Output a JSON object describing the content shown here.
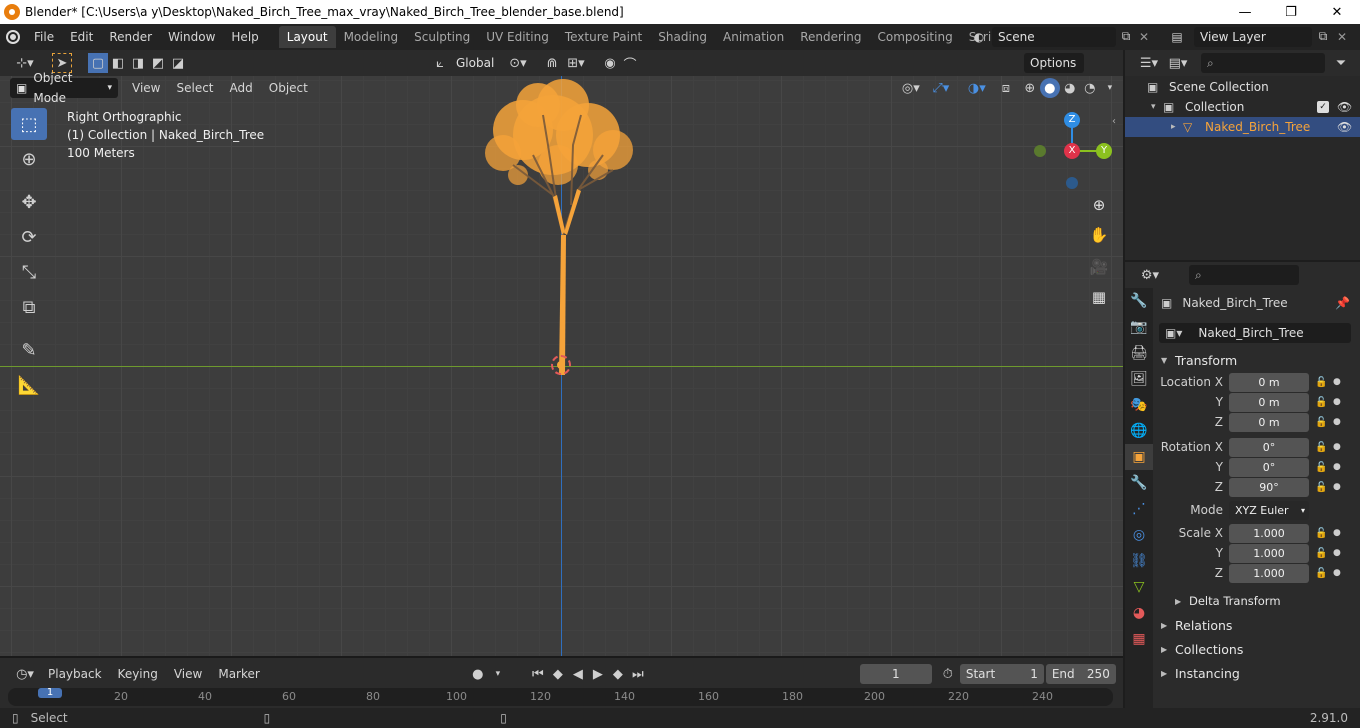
{
  "window": {
    "title": "Blender* [C:\\Users\\a y\\Desktop\\Naked_Birch_Tree_max_vray\\Naked_Birch_Tree_blender_base.blend]",
    "minimize": "—",
    "maximize": "❐",
    "close": "✕"
  },
  "menu": [
    "File",
    "Edit",
    "Render",
    "Window",
    "Help"
  ],
  "workspaces": [
    {
      "label": "Layout",
      "active": true
    },
    {
      "label": "Modeling"
    },
    {
      "label": "Sculpting"
    },
    {
      "label": "UV Editing"
    },
    {
      "label": "Texture Paint"
    },
    {
      "label": "Shading"
    },
    {
      "label": "Animation"
    },
    {
      "label": "Rendering"
    },
    {
      "label": "Compositing"
    },
    {
      "label": "Scripting"
    }
  ],
  "scene": {
    "name": "Scene"
  },
  "view_layer": {
    "name": "View Layer"
  },
  "viewport_header": {
    "transform_orientation": "Global",
    "options_label": "Options"
  },
  "viewport_menu": {
    "mode": "Object Mode",
    "items": [
      "View",
      "Select",
      "Add",
      "Object"
    ]
  },
  "viewport_overlay": {
    "view_name": "Right Orthographic",
    "collection_info": "(1) Collection | Naked_Birch_Tree",
    "scale": "100 Meters"
  },
  "gizmo": {
    "z": "Z",
    "x": "X",
    "y": "Y"
  },
  "timeline": {
    "menus": [
      "Playback",
      "Keying",
      "View",
      "Marker"
    ],
    "current_frame": "1",
    "start_label": "Start",
    "start": "1",
    "end_label": "End",
    "end": "250",
    "ticks": [
      "1",
      "20",
      "40",
      "60",
      "80",
      "100",
      "120",
      "140",
      "160",
      "180",
      "200",
      "220",
      "240"
    ]
  },
  "statusbar": {
    "select_label": "Select",
    "version": "2.91.0"
  },
  "outliner": {
    "rows": [
      {
        "label": "Scene Collection"
      },
      {
        "label": "Collection"
      },
      {
        "label": "Naked_Birch_Tree",
        "selected": true
      }
    ]
  },
  "properties": {
    "object_name": "Naked_Birch_Tree",
    "object_field": "Naked_Birch_Tree",
    "transform_label": "Transform",
    "location": {
      "label": "Location X",
      "x": "0 m",
      "y": "0 m",
      "z": "0 m"
    },
    "rotation": {
      "label": "Rotation X",
      "x": "0°",
      "y": "0°",
      "z": "90°"
    },
    "mode_label": "Mode",
    "mode_value": "XYZ Euler",
    "scale": {
      "label": "Scale X",
      "x": "1.000",
      "y": "1.000",
      "z": "1.000"
    },
    "y_label": "Y",
    "z_label": "Z",
    "delta_transform": "Delta Transform",
    "relations": "Relations",
    "collections": "Collections",
    "instancing": "Instancing"
  },
  "colors": {
    "accent_blue": "#4772b3",
    "selection_orange": "#f5a33a",
    "axis_red": "#e0334a",
    "axis_green": "#8bc11f",
    "axis_blue": "#2f8de4"
  }
}
